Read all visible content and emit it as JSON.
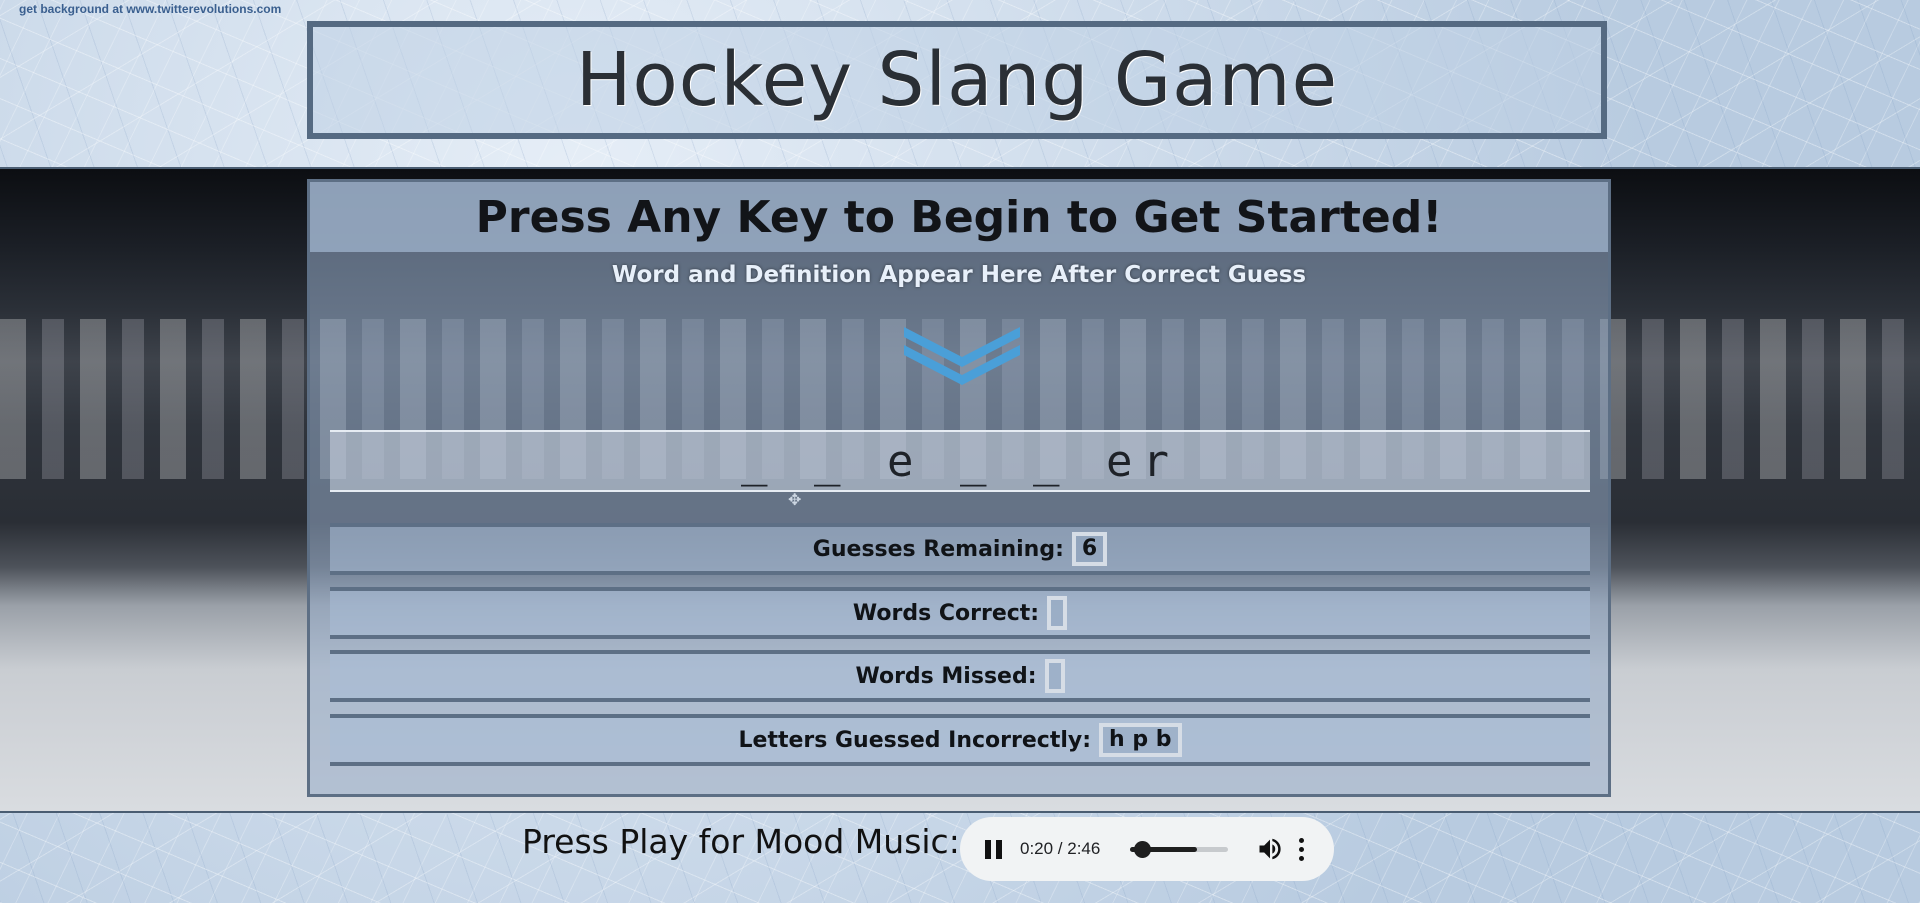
{
  "credit_text": "get background at www.twitterevolutions.com",
  "header": {
    "title": "Hockey Slang Game"
  },
  "panel": {
    "title": "Press Any Key to Begin to Get Started!",
    "subtitle": "Word and Definition Appear Here After Correct Guess",
    "chevron_icon": "chevron-down-icon",
    "accent_color": "#4a9fd8",
    "current_word": "_ _ e _ _ er"
  },
  "stats": {
    "guesses_remaining_label": "Guesses Remaining:",
    "guesses_remaining_value": "6",
    "words_correct_label": "Words Correct:",
    "words_correct_value": "",
    "words_missed_label": "Words Missed:",
    "words_missed_value": "",
    "letters_incorrect_label": "Letters Guessed Incorrectly:",
    "letters_incorrect_value": "h p b"
  },
  "music": {
    "label": "Press Play for Mood Music:",
    "time_display": "0:20 / 2:46",
    "progress_fraction": 0.12,
    "volume_fraction": 0.68,
    "state": "playing"
  }
}
